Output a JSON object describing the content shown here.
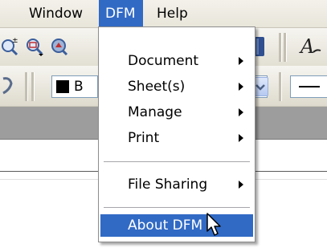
{
  "menubar": {
    "items": [
      {
        "label": "Window"
      },
      {
        "label": "DFM"
      },
      {
        "label": "Help"
      }
    ]
  },
  "toolbar": {
    "font_field_text": "B",
    "icons": [
      "zoom-in-icon",
      "zoom-area-icon",
      "pan-icon",
      "book-icon",
      "text-tool-icon"
    ]
  },
  "dfm_menu": {
    "items": [
      {
        "label": "Document",
        "submenu": true
      },
      {
        "label": "Sheet(s)",
        "submenu": true
      },
      {
        "label": "Manage",
        "submenu": true
      },
      {
        "label": "Print",
        "submenu": true
      },
      {
        "label": "File Sharing",
        "submenu": true
      },
      {
        "label": "About DFM",
        "submenu": false,
        "highlighted": true
      }
    ]
  },
  "colors": {
    "highlight": "#316ac5",
    "menubar": "#ece9d8",
    "workspace_band": "#9d9d9d"
  }
}
